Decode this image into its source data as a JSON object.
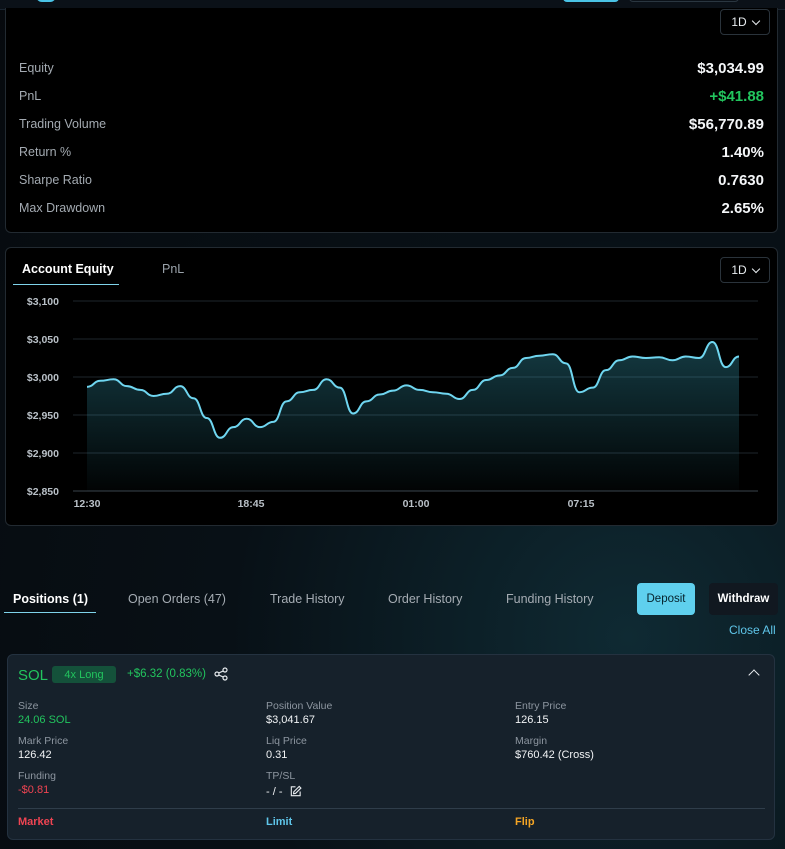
{
  "stats": {
    "timeframe": "1D",
    "rows": [
      {
        "label": "Equity",
        "value": "$3,034.99"
      },
      {
        "label": "PnL",
        "value": "+$41.88"
      },
      {
        "label": "Trading Volume",
        "value": "$56,770.89"
      },
      {
        "label": "Return %",
        "value": "1.40%"
      },
      {
        "label": "Sharpe Ratio",
        "value": "0.7630"
      },
      {
        "label": "Max Drawdown",
        "value": "2.65%"
      }
    ]
  },
  "chart_tabs": {
    "active": "Account Equity",
    "inactive": "PnL",
    "timeframe": "1D"
  },
  "chart_data": {
    "type": "area",
    "title": "",
    "xlabel": "",
    "ylabel": "",
    "x_ticks": [
      "12:30",
      "18:45",
      "01:00",
      "07:15"
    ],
    "y_ticks": [
      "$3,100",
      "$3,050",
      "$3,000",
      "$2,950",
      "$2,900",
      "$2,850"
    ],
    "ylim": [
      2850,
      3100
    ],
    "grid": true,
    "line_color": "#6fd6f0",
    "x": [
      "12:30",
      "13:00",
      "13:30",
      "14:00",
      "14:30",
      "15:00",
      "15:30",
      "16:00",
      "16:30",
      "17:00",
      "17:30",
      "18:00",
      "18:30",
      "19:00",
      "19:30",
      "20:00",
      "20:30",
      "21:00",
      "21:30",
      "22:00",
      "22:30",
      "23:00",
      "23:30",
      "00:00",
      "00:30",
      "01:00",
      "01:30",
      "02:00",
      "02:30",
      "03:00",
      "03:30",
      "04:00",
      "04:30",
      "05:00",
      "05:30",
      "06:00",
      "06:30",
      "07:00",
      "07:30",
      "08:00",
      "08:30",
      "09:00",
      "09:30",
      "10:00",
      "10:30",
      "11:00",
      "11:30",
      "12:00",
      "12:30",
      "13:00"
    ],
    "values": [
      2987,
      2995,
      2997,
      2988,
      2983,
      2975,
      2978,
      2988,
      2972,
      2946,
      2920,
      2934,
      2945,
      2934,
      2941,
      2968,
      2980,
      2983,
      2997,
      2986,
      2952,
      2968,
      2977,
      2982,
      2989,
      2983,
      2980,
      2978,
      2971,
      2983,
      2996,
      3002,
      3012,
      3025,
      3028,
      3030,
      3018,
      2980,
      2986,
      3009,
      3022,
      3027,
      3025,
      3026,
      3022,
      3027,
      3025,
      3046,
      3013,
      3027
    ]
  },
  "positions_tabs": [
    {
      "label": "Positions (1)"
    },
    {
      "label": "Open Orders (47)"
    },
    {
      "label": "Trade History"
    },
    {
      "label": "Order History"
    },
    {
      "label": "Funding History"
    }
  ],
  "buttons": {
    "deposit": "Deposit",
    "withdraw": "Withdraw",
    "close_all": "Close All"
  },
  "position": {
    "symbol": "SOL",
    "leverage": "4x Long",
    "pnl": "+$6.32 (0.83%)",
    "fields": {
      "size_label": "Size",
      "size_value": "24.06 SOL",
      "position_value_label": "Position Value",
      "position_value": "$3,041.67",
      "entry_price_label": "Entry Price",
      "entry_price": "126.15",
      "mark_price_label": "Mark Price",
      "mark_price": "126.42",
      "liq_price_label": "Liq Price",
      "liq_price": "0.31",
      "margin_label": "Margin",
      "margin": "$760.42 (Cross)",
      "funding_label": "Funding",
      "funding": "-$0.81",
      "tpsl_label": "TP/SL",
      "tpsl": "- / -"
    },
    "actions": {
      "market": "Market",
      "limit": "Limit",
      "flip": "Flip"
    }
  }
}
